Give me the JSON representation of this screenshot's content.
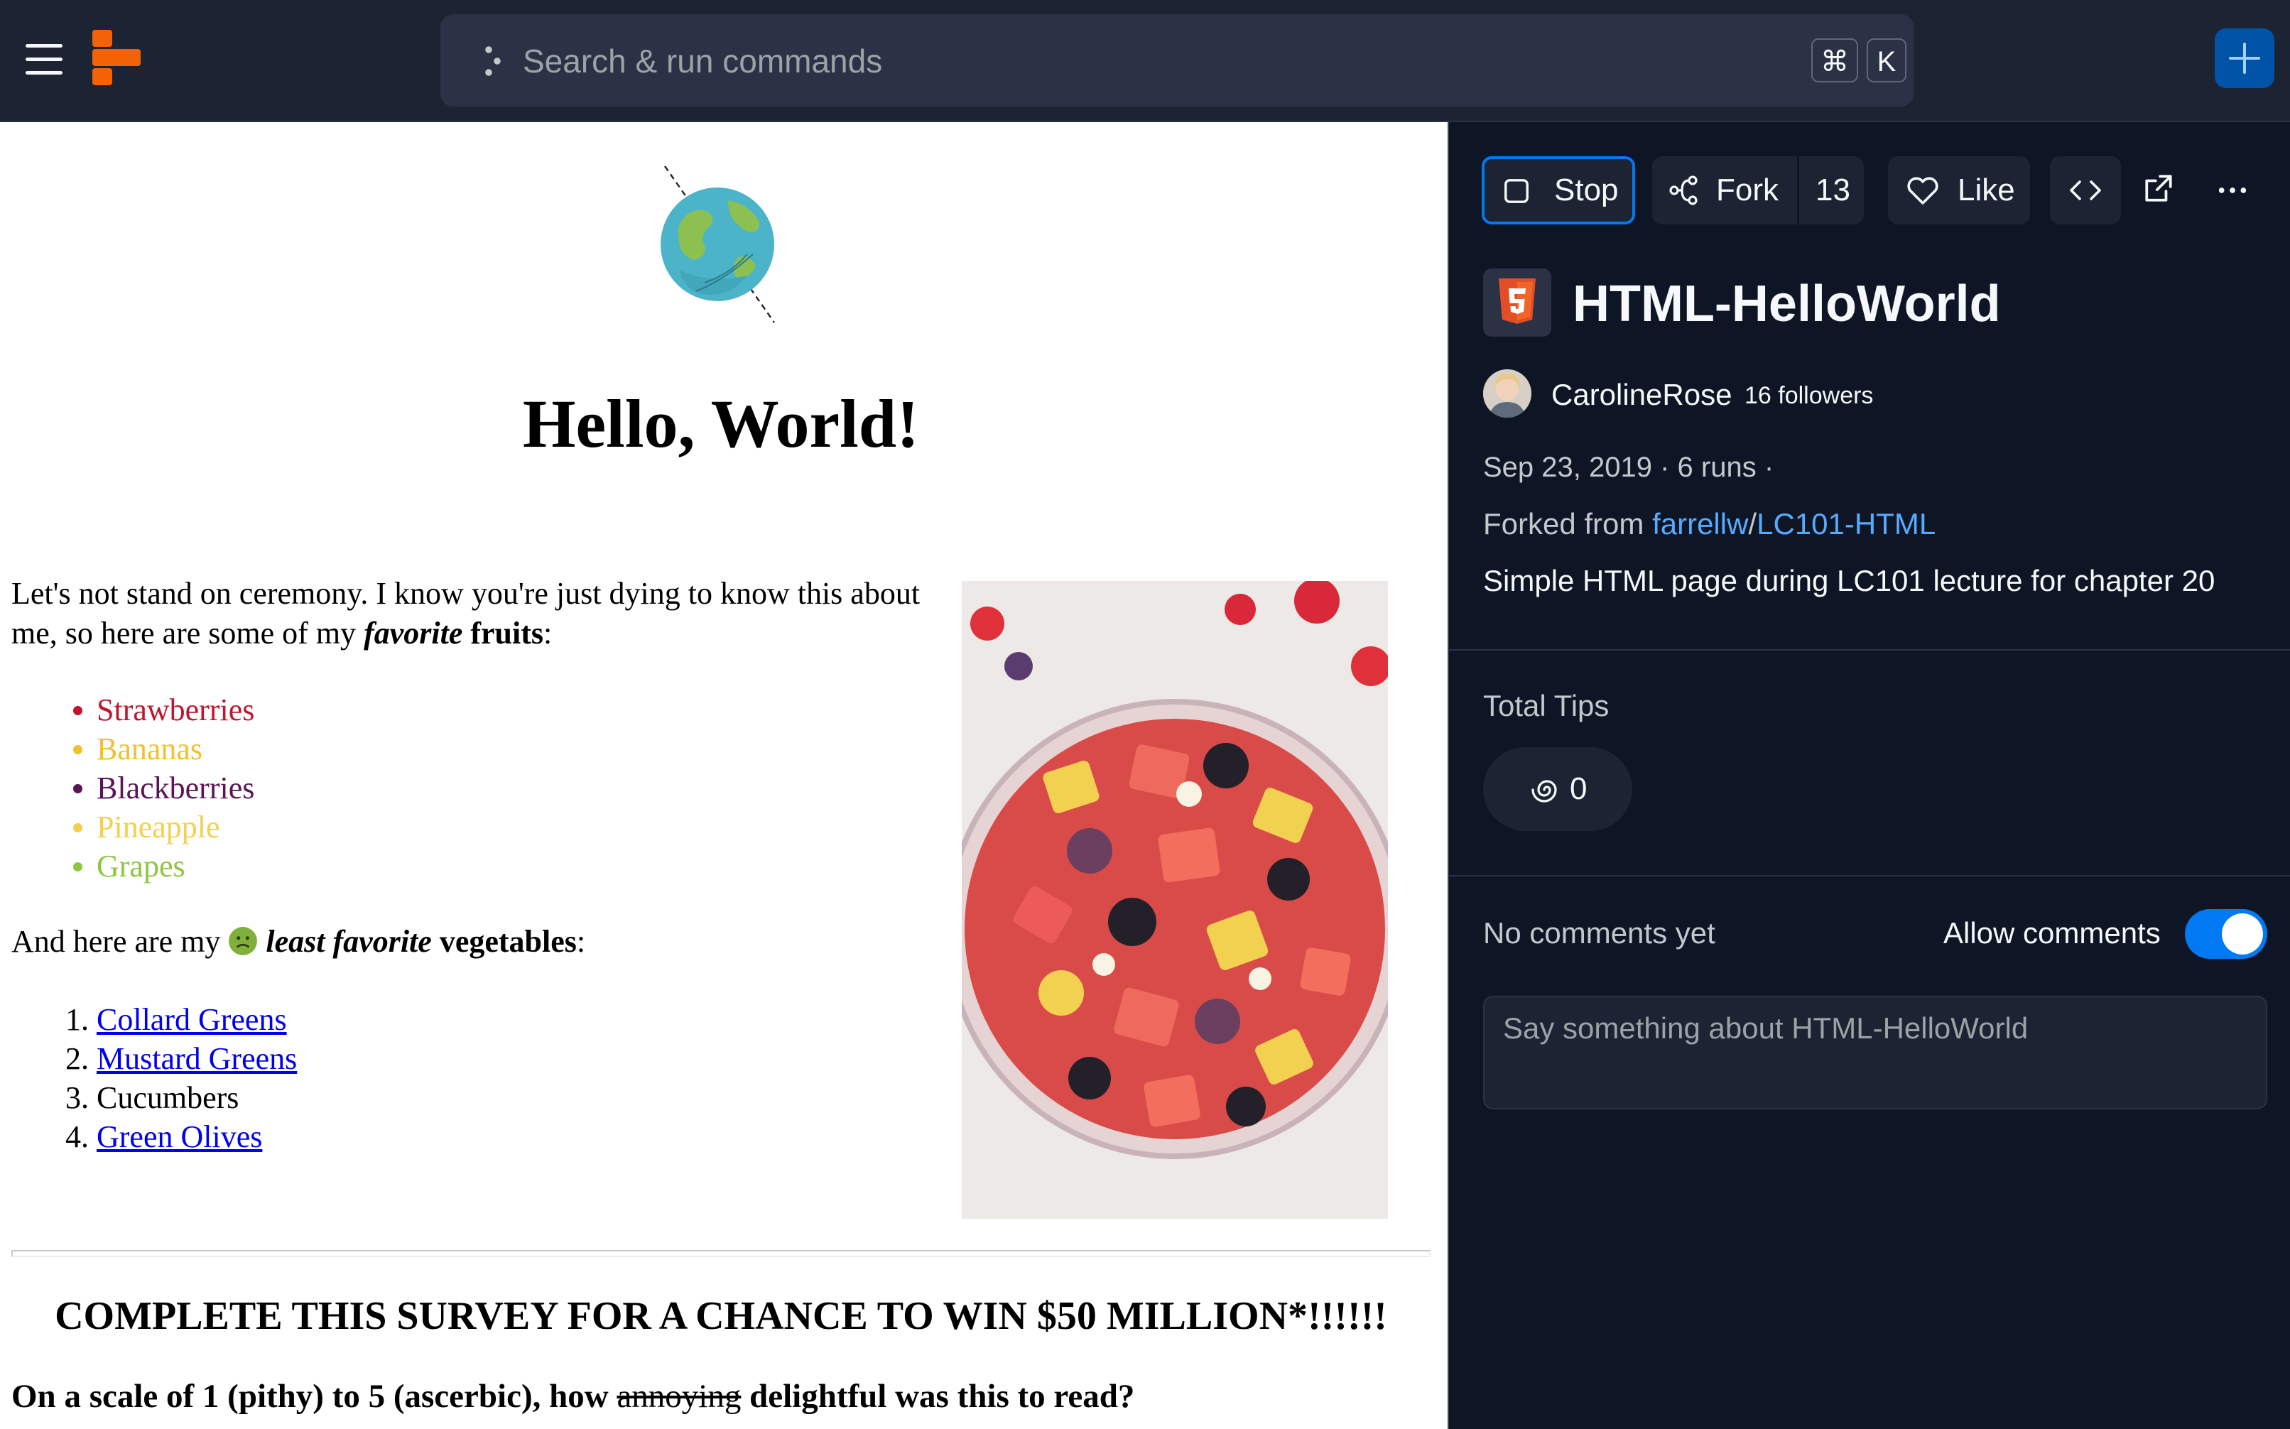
{
  "topbar": {
    "search_placeholder": "Search & run commands",
    "shortcut_cmd": "⌘",
    "shortcut_key": "K"
  },
  "preview": {
    "heading": "Hello, World!",
    "intro_1": "Let's not stand on ceremony. I know you're just dying to know this about me, so here are some of my ",
    "intro_em": "favorite",
    "intro_strong": "fruits",
    "intro_end": ":",
    "fruits": [
      {
        "name": "Strawberries",
        "color": "#c0152f"
      },
      {
        "name": "Bananas",
        "color": "#f2c12e"
      },
      {
        "name": "Blackberries",
        "color": "#5b1457"
      },
      {
        "name": "Pineapple",
        "color": "#f3d04e"
      },
      {
        "name": "Grapes",
        "color": "#8dc63f"
      }
    ],
    "veg_intro_1": "And here are my",
    "veg_intro_em": "least favorite",
    "veg_intro_strong": "vegetables",
    "veg_intro_end": ":",
    "vegetables": [
      {
        "name": "Collard Greens",
        "link": true
      },
      {
        "name": "Mustard Greens",
        "link": true
      },
      {
        "name": "Cucumbers",
        "link": false
      },
      {
        "name": "Green Olives",
        "link": true
      }
    ],
    "survey_title": "COMPLETE THIS SURVEY FOR A CHANCE TO WIN $50 MILLION*!!!!!!",
    "survey_q_1": "On a scale of 1 (pithy) to 5 (ascerbic), how",
    "survey_q_strike": "annoying",
    "survey_q_2": "delightful was this to read?"
  },
  "panel": {
    "stop_label": "Stop",
    "fork_label": "Fork",
    "fork_count": "13",
    "like_label": "Like",
    "title": "HTML-HelloWorld",
    "author": "CarolineRose",
    "followers": "16 followers",
    "meta": "Sep 23, 2019 · 6 runs ·",
    "forked_prefix": "Forked from",
    "forked_user": "farrellw",
    "forked_sep": "/",
    "forked_repl": "LC101-HTML",
    "description": "Simple HTML page during LC101 lecture for chapter 20",
    "tips_label": "Total Tips",
    "tips_value": "0",
    "no_comments": "No comments yet",
    "allow_comments": "Allow comments",
    "allow_comments_on": true,
    "comment_placeholder": "Say something about HTML-HelloWorld"
  },
  "colors": {
    "topbar_bg": "#1c2333",
    "panel_bg": "#0e1525",
    "accent_blue": "#0079f2",
    "link_blue": "#57abff",
    "logo_orange": "#f26207",
    "html5_orange": "#e44d26"
  },
  "icons": {
    "menu": "hamburger-icon",
    "logo": "replit-logo",
    "search": "command-dots-icon",
    "new": "plus-icon",
    "stop": "stop-square-icon",
    "fork": "fork-icon",
    "like": "heart-icon",
    "code": "code-brackets-icon",
    "open": "external-link-icon",
    "more": "more-horizontal-icon",
    "language": "html5-icon",
    "tips": "spiral-cycles-icon"
  }
}
